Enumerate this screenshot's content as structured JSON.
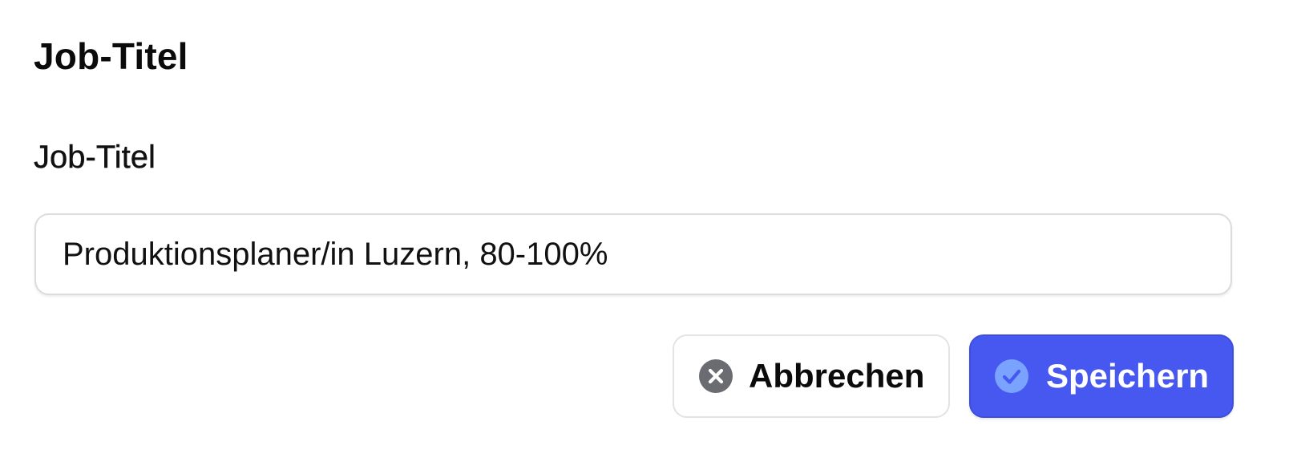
{
  "section": {
    "title": "Job-Titel"
  },
  "field": {
    "label": "Job-Titel",
    "value": "Produktionsplaner/in Luzern, 80-100%"
  },
  "actions": {
    "cancel_label": "Abbrechen",
    "cancel_icon": "x-circle-icon",
    "save_label": "Speichern",
    "save_icon": "check-circle-icon"
  },
  "colors": {
    "primary": "#4758f0",
    "cancel_icon": "#6b6b72",
    "save_icon_fill": "#7aa2ff"
  }
}
